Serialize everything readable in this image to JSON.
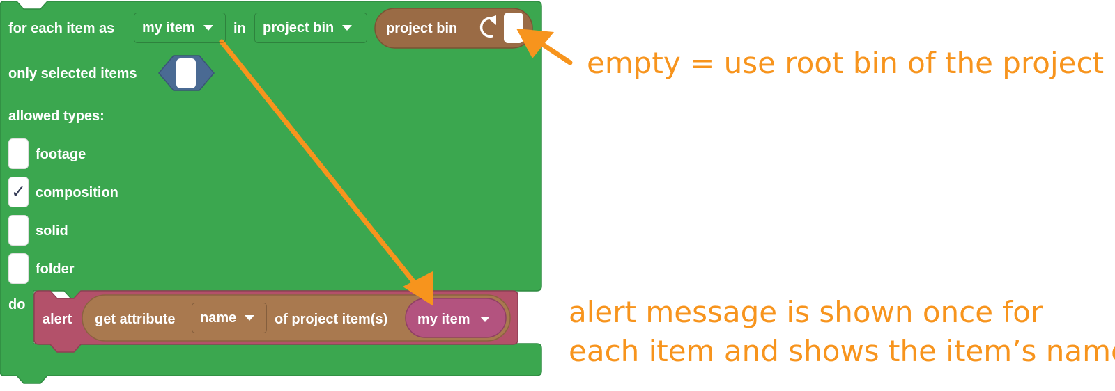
{
  "colors": {
    "loop_block": "#3ba74f",
    "project_reporter": "#9a6b45",
    "alert_block": "#b3516a",
    "get_attribute_block": "#a9794f",
    "variable_pill": "#b3537f",
    "boolean_slot": "#4a6a93",
    "annotation": "#f7941d"
  },
  "loop": {
    "prefix": "for each item as",
    "var_dropdown": "my item",
    "in_label": "in",
    "source_dropdown": "project bin",
    "reporter_label": "project bin",
    "refresh_icon": "refresh-icon",
    "only_selected_label": "only selected items",
    "allowed_types_label": "allowed types:",
    "types": [
      {
        "label": "footage",
        "checked": false,
        "mark": ""
      },
      {
        "label": "composition",
        "checked": true,
        "mark": "✓"
      },
      {
        "label": "solid",
        "checked": false,
        "mark": ""
      },
      {
        "label": "folder",
        "checked": false,
        "mark": ""
      }
    ],
    "do_label": "do"
  },
  "alert": {
    "label": "alert",
    "get_attribute_label": "get attribute",
    "attribute_dropdown": "name",
    "of_label": "of project item(s)",
    "item_dropdown": "my item"
  },
  "annotations": {
    "top": "empty = use root bin of the project",
    "bottom_line1": "alert message is shown once for",
    "bottom_line2": "each item and shows the item’s name."
  }
}
